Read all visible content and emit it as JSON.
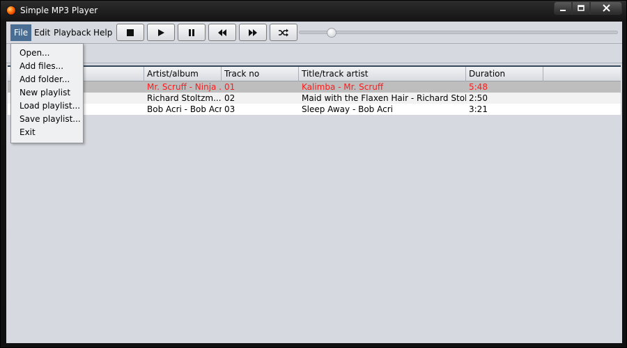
{
  "window": {
    "title": "Simple MP3 Player",
    "buttons": {
      "minimize": "—",
      "maximize": "□",
      "close": "✕"
    }
  },
  "menubar": {
    "items": [
      "File",
      "Edit",
      "Playback",
      "Help"
    ],
    "active": "File"
  },
  "toolbar": {
    "buttons": [
      "stop-icon",
      "play-icon",
      "pause-icon",
      "rewind-icon",
      "fast-forward-icon",
      "shuffle-icon"
    ],
    "position_fraction": 0.09
  },
  "file_menu": {
    "items": [
      "Open...",
      "Add files...",
      "Add folder...",
      "New playlist",
      "Load playlist...",
      "Save playlist...",
      "Exit"
    ]
  },
  "playlist": {
    "columns": [
      "",
      "Artist/album",
      "Track no",
      "Title/track artist",
      "Duration"
    ],
    "rows": [
      {
        "col0": "",
        "artist_album": "Mr. Scruff - Ninja ...",
        "track_no": "01",
        "title": "Kalimba - Mr. Scruff",
        "duration": "5:48"
      },
      {
        "col0": "",
        "artist_album": "Richard Stoltzm...",
        "track_no": "02",
        "title": "Maid with the Flaxen Hair - Richard Stoltz...",
        "duration": "2:50"
      },
      {
        "col0": "",
        "artist_album": "Bob Acri - Bob Acri",
        "track_no": "03",
        "title": "Sleep Away - Bob Acri",
        "duration": "3:21"
      }
    ],
    "now_playing_color": "#ff1a1a"
  }
}
